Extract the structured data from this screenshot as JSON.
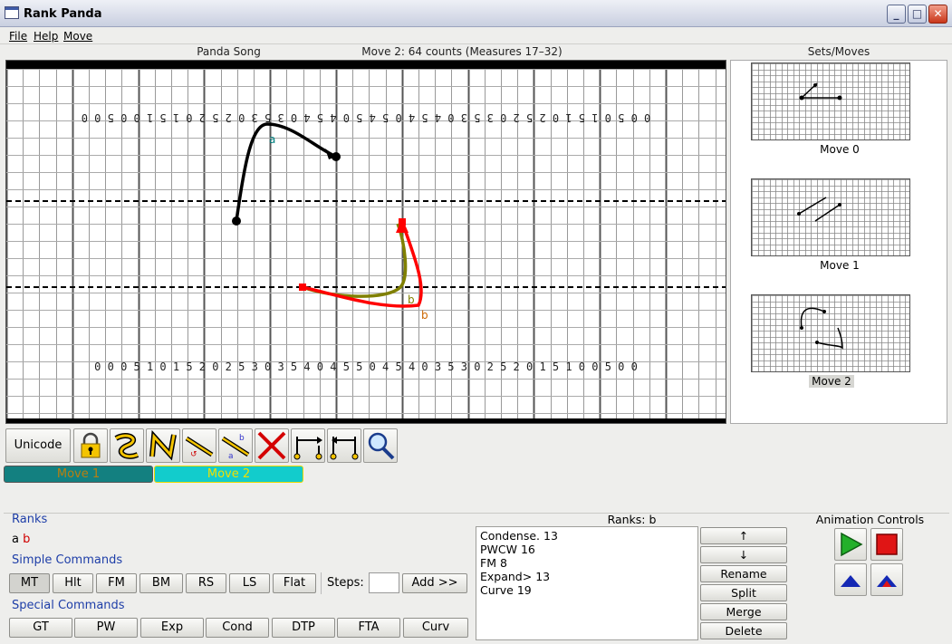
{
  "window": {
    "title": "Rank Panda",
    "min": "_",
    "max": "□",
    "close": "✕"
  },
  "menu": [
    "File",
    "Help",
    "Move"
  ],
  "header": {
    "song": "Panda Song",
    "move_info": "Move 2: 64 counts (Measures 17–32)",
    "sets_title": "Sets/Moves"
  },
  "field": {
    "top_numbers": "0 0 5 0 1 5 1 0 2 5 2 0 3 5 3 0 4 5 4 0 5 4 5 0 4 5 4 0 3 5 3 0 2 5 2 0 1 5 1 0 0 5 0 0",
    "bottom_numbers": "0 0 0 5 1 0 1 5 2 0 2 5 3 0 3 5 4 0 4 5 5 0 4 5 4 0 3 5 3 0 2 5 2 0 1 5 1 0 0 5 0 0",
    "labels": {
      "rank_a": "a",
      "rank_b_1": "b",
      "rank_b_2": "b"
    },
    "colors": {
      "rank_a": "#000000",
      "rank_b_current": "#ff0000",
      "rank_b_prev": "#808000",
      "label_a": "#008080",
      "label_b": "#cc6600"
    }
  },
  "moves": [
    {
      "label": "Move 0"
    },
    {
      "label": "Move 1"
    },
    {
      "label": "Move 2"
    }
  ],
  "toolbar": {
    "unicode": "Unicode",
    "tools": [
      "lock-icon",
      "curve-icon",
      "zigzag-icon",
      "line-edit-icon",
      "line-split-icon",
      "delete-icon",
      "expand-right-icon",
      "expand-left-icon",
      "zoom-icon"
    ]
  },
  "timeline": {
    "move1": "Move 1",
    "move2": "Move 2"
  },
  "ranks": {
    "title": "Ranks",
    "a": "a",
    "b": "b"
  },
  "simple": {
    "title": "Simple Commands",
    "buttons": [
      "MT",
      "Hlt",
      "FM",
      "BM",
      "RS",
      "LS",
      "Flat"
    ],
    "steps_label": "Steps:",
    "add": "Add >>"
  },
  "special": {
    "title": "Special Commands",
    "buttons": [
      "GT",
      "PW",
      "Exp",
      "Cond",
      "DTP",
      "FTA",
      "Curv"
    ]
  },
  "commands": {
    "title": "Ranks: b",
    "items": [
      "Condense. 13",
      "PWCW 16",
      "FM 8",
      "Expand> 13",
      "Curve 19"
    ],
    "up": "↑",
    "down": "↓",
    "rename": "Rename",
    "split": "Split",
    "merge": "Merge",
    "delete": "Delete"
  },
  "animation": {
    "title": "Animation Controls",
    "play": "play-icon",
    "stop": "stop-icon",
    "step": "step-icon",
    "step_all": "step-all-icon"
  }
}
